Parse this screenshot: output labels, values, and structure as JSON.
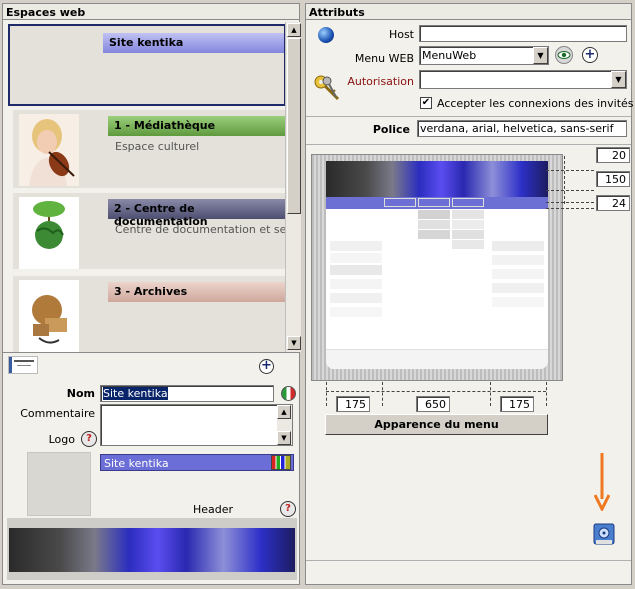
{
  "left_panel": {
    "title": "Espaces web",
    "items": [
      {
        "title": "Site kentika",
        "subtitle": ""
      },
      {
        "title": "1 - Médiathèque",
        "subtitle": "Espace culturel"
      },
      {
        "title": "2 - Centre de documentation",
        "subtitle": "Centre de documentation et service"
      },
      {
        "title": "3 - Archives",
        "subtitle": ""
      }
    ],
    "form": {
      "nom_label": "Nom",
      "nom_value": "Site kentika",
      "commentaire_label": "Commentaire",
      "logo_label": "Logo",
      "style_value": "Site kentika",
      "header_label": "Header"
    }
  },
  "right_panel": {
    "title": "Attributs",
    "host_label": "Host",
    "host_value": "",
    "menu_web_label": "Menu WEB",
    "menu_web_value": "MenuWeb",
    "autorisation_label": "Autorisation",
    "autorisation_value": "",
    "guest_checkbox_label": "Accepter les connexions des invités",
    "guest_checked": true,
    "police_label": "Police",
    "police_value": "verdana, arial, helvetica, sans-serif",
    "dims_right": [
      "20",
      "150",
      "24"
    ],
    "dims_bottom": [
      "175",
      "650",
      "175"
    ],
    "menu_button_label": "Apparence du menu"
  },
  "colors": {
    "accent_arrow": "#f07820",
    "item0_bar": "#8c8ee6",
    "item1_bar": "#6aa34a",
    "item2_bar": "#55557a",
    "item3_bar": "#d8b8b0"
  }
}
